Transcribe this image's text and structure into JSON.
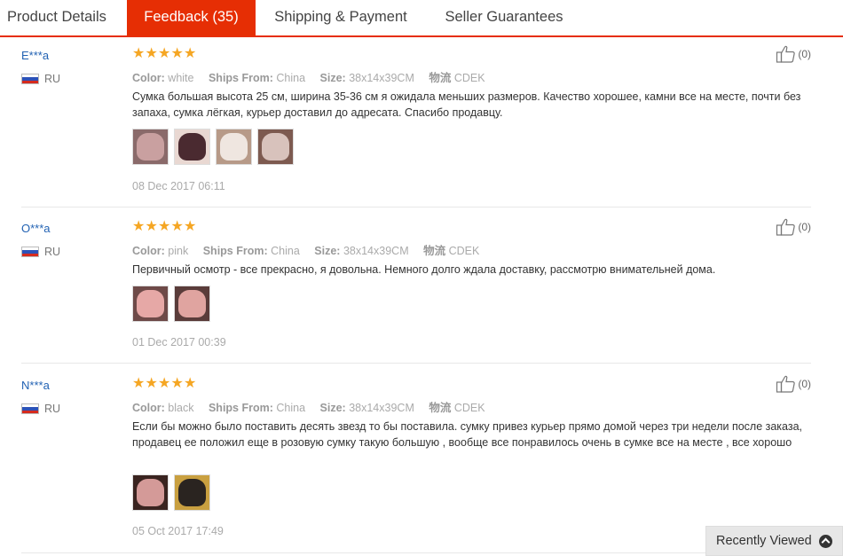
{
  "tabs": [
    {
      "label": "Product Details",
      "active": false
    },
    {
      "label": "Feedback (35)",
      "active": true
    },
    {
      "label": "Shipping & Payment",
      "active": false
    },
    {
      "label": "Seller Guarantees",
      "active": false
    }
  ],
  "attr_labels": {
    "color": "Color:",
    "ships_from": "Ships From:",
    "size": "Size:",
    "logistics": "物流"
  },
  "reviews": [
    {
      "user": "E***a",
      "country": "RU",
      "rating": 5,
      "color": "white",
      "ships_from": "China",
      "size": "38x14x39CM",
      "logistics": "CDEK",
      "text": "Сумка большая высота 25 см, ширина 35-36 см я ожидала меньших размеров. Качество хорошее, камни все на месте, почти без запаха, сумка лёгкая, курьер доставил до адресата. Спасибо продавцу.",
      "photos": 4,
      "date": "08 Dec 2017 06:11",
      "helpful": "(0)"
    },
    {
      "user": "O***a",
      "country": "RU",
      "rating": 5,
      "color": "pink",
      "ships_from": "China",
      "size": "38x14x39CM",
      "logistics": "CDEK",
      "text": "Первичный осмотр - все прекрасно, я довольна. Немного долго ждала доставку, рассмотрю внимательней дома.",
      "photos": 2,
      "date": "01 Dec 2017 00:39",
      "helpful": "(0)"
    },
    {
      "user": "N***a",
      "country": "RU",
      "rating": 5,
      "color": "black",
      "ships_from": "China",
      "size": "38x14x39CM",
      "logistics": "CDEK",
      "text": "Если бы можно было поставить десять звезд то бы поставила. сумку привез курьер прямо домой через три недели после заказа, продавец ее положил еще в розовую сумку такую большую , вообще все понравилось очень в сумке все на месте , все хорошо",
      "photos": 2,
      "date": "05 Oct 2017 17:49",
      "helpful": "(0)"
    }
  ],
  "recently_viewed": {
    "label": "Recently Viewed",
    "icon": "chevron-up-circle-icon"
  },
  "colors": {
    "accent": "#e62e04",
    "username": "#2262b3",
    "star": "#f5a623"
  }
}
